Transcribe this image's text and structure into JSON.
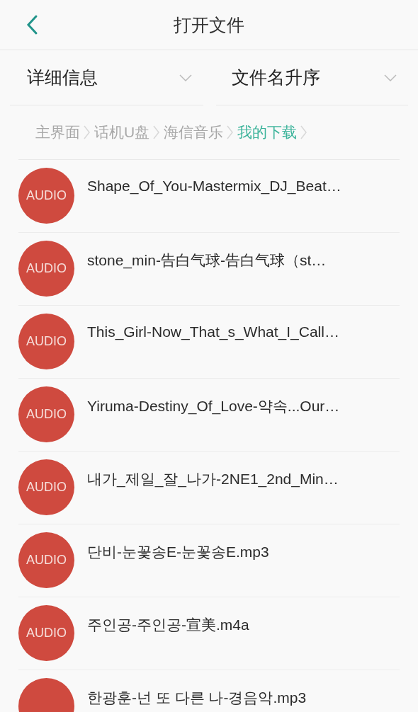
{
  "header": {
    "title": "打开文件"
  },
  "dropdowns": [
    {
      "label": "详细信息"
    },
    {
      "label": "文件名升序"
    }
  ],
  "breadcrumb": [
    {
      "label": "主界面",
      "selected": false
    },
    {
      "label": "话机U盘",
      "selected": false
    },
    {
      "label": "海信音乐",
      "selected": false
    },
    {
      "label": "我的下载",
      "selected": true
    }
  ],
  "files": [
    {
      "kind": "audio",
      "badge": "AUDIO",
      "name": "Shape_Of_You-Mastermix_DJ_Beat…"
    },
    {
      "kind": "audio",
      "badge": "AUDIO",
      "name": "stone_min-告白气球-告白气球（st…"
    },
    {
      "kind": "audio",
      "badge": "AUDIO",
      "name": "This_Girl-Now_That_s_What_I_Call…"
    },
    {
      "kind": "audio",
      "badge": "AUDIO",
      "name": "Yiruma-Destiny_Of_Love-약속...Our…"
    },
    {
      "kind": "audio",
      "badge": "AUDIO",
      "name": "내가_제일_잘_나가-2NE1_2nd_Min…"
    },
    {
      "kind": "audio",
      "badge": "AUDIO",
      "name": "단비-눈꽃송E-눈꽃송E.mp3"
    },
    {
      "kind": "audio",
      "badge": "AUDIO",
      "name": "주인공-주인공-宣美.m4a"
    },
    {
      "kind": "audio",
      "name": "한광훈-넌 또 다른 나-경음악.mp3"
    }
  ]
}
